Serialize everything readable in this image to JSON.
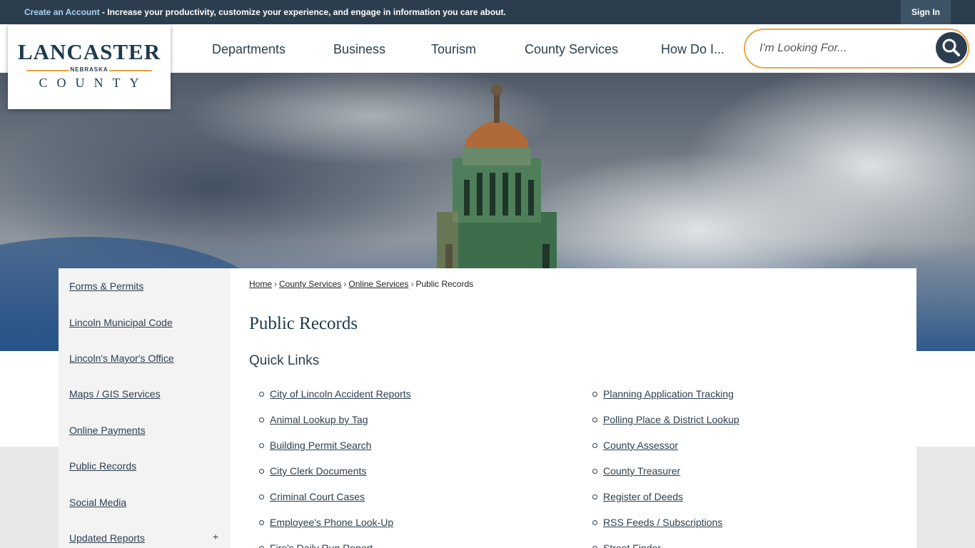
{
  "topbar": {
    "create_account": "Create an Account",
    "message": " - Increase your productivity, customize your experience, and engage in information you care about.",
    "sign_in": "Sign In"
  },
  "logo": {
    "line1": "LANCASTER",
    "line2": "NEBRASKA",
    "line3": "COUNTY"
  },
  "nav": [
    "Departments",
    "Business",
    "Tourism",
    "County Services",
    "How Do I..."
  ],
  "search": {
    "placeholder": "I'm Looking For...",
    "icon": "search-icon"
  },
  "sidebar": {
    "items": [
      "Forms & Permits",
      "Lincoln Municipal Code",
      "Lincoln's Mayor's Office",
      "Maps / GIS Services",
      "Online Payments",
      "Public Records",
      "Social Media",
      "Updated Reports"
    ],
    "expand": "+"
  },
  "breadcrumb": [
    "Home",
    "County Services",
    "Online Services",
    "Public Records"
  ],
  "page_title": "Public Records",
  "quick_links": {
    "heading": "Quick Links",
    "left": [
      "City of Lincoln Accident Reports",
      "Animal Lookup by Tag",
      "Building Permit Search",
      "City Clerk Documents",
      "Criminal Court Cases",
      "Employee's Phone Look-Up",
      "Fire's Daily Run Report"
    ],
    "right": [
      "Planning Application Tracking",
      "Polling Place & District Lookup",
      "County Assessor",
      "County Treasurer",
      "Register of Deeds",
      "RSS Feeds / Subscriptions",
      "Street Finder"
    ]
  },
  "colors": {
    "navy": "#2c3e4e",
    "accent": "#e8a646",
    "link_light": "#a9d4f0"
  }
}
